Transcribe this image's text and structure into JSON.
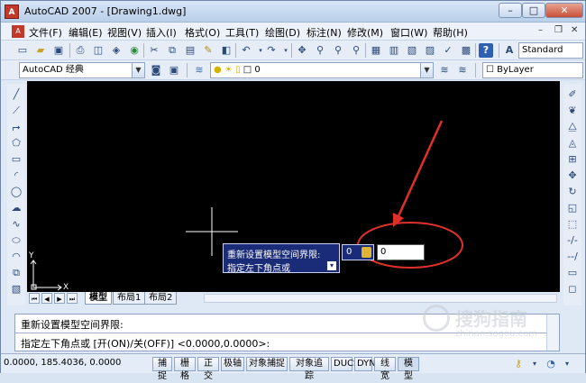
{
  "window": {
    "title": "AutoCAD 2007 - [Drawing1.dwg]",
    "app_icon_text": "A",
    "controls": {
      "minimize": "–",
      "maximize": "□",
      "close": "✕"
    }
  },
  "menubar": {
    "doc_icon_text": "A",
    "items": [
      {
        "label": "文件(F)"
      },
      {
        "label": "编辑(E)"
      },
      {
        "label": "视图(V)"
      },
      {
        "label": "插入(I)"
      },
      {
        "label": "格式(O)"
      },
      {
        "label": "工具(T)"
      },
      {
        "label": "绘图(D)"
      },
      {
        "label": "标注(N)"
      },
      {
        "label": "修改(M)"
      },
      {
        "label": "窗口(W)"
      },
      {
        "label": "帮助(H)"
      }
    ],
    "mdi_controls": {
      "minimize": "–",
      "restore": "❐",
      "close": "✕"
    }
  },
  "toolbars": {
    "text_style": "Standard",
    "workspace": "AutoCAD 经典",
    "layer": "0",
    "color": "ByLayer"
  },
  "tooltip": {
    "line1": "重新设置模型空间界限:",
    "line2": "指定左下角点或"
  },
  "dynamic_input": {
    "locked_value": "0",
    "input_value": "0"
  },
  "layout_tabs": [
    {
      "label": "模型"
    },
    {
      "label": "布局1"
    },
    {
      "label": "布局2"
    }
  ],
  "command_window": {
    "line1": "重新设置模型空间界限:",
    "line2": "指定左下角点或 [开(ON)/关(OFF)] <0.0000,0.0000>:"
  },
  "statusbar": {
    "coords": "0.0000,   185.4036, 0.0000",
    "buttons": [
      {
        "label": "捕捉"
      },
      {
        "label": "栅格"
      },
      {
        "label": "正交"
      },
      {
        "label": "极轴"
      },
      {
        "label": "对象捕捉"
      },
      {
        "label": "对象追踪"
      },
      {
        "label": "DUCS"
      },
      {
        "label": "DYN"
      },
      {
        "label": "线宽"
      },
      {
        "label": "模型"
      }
    ]
  },
  "ucs": {
    "x_label": "X",
    "y_label": "Y"
  },
  "watermark": {
    "text": "搜狗指南",
    "url": "zhinan.sogou.com"
  },
  "colors": {
    "canvas": "#000000",
    "annotation_red": "#e0302a",
    "tooltip_bg": "#1a2b78"
  }
}
